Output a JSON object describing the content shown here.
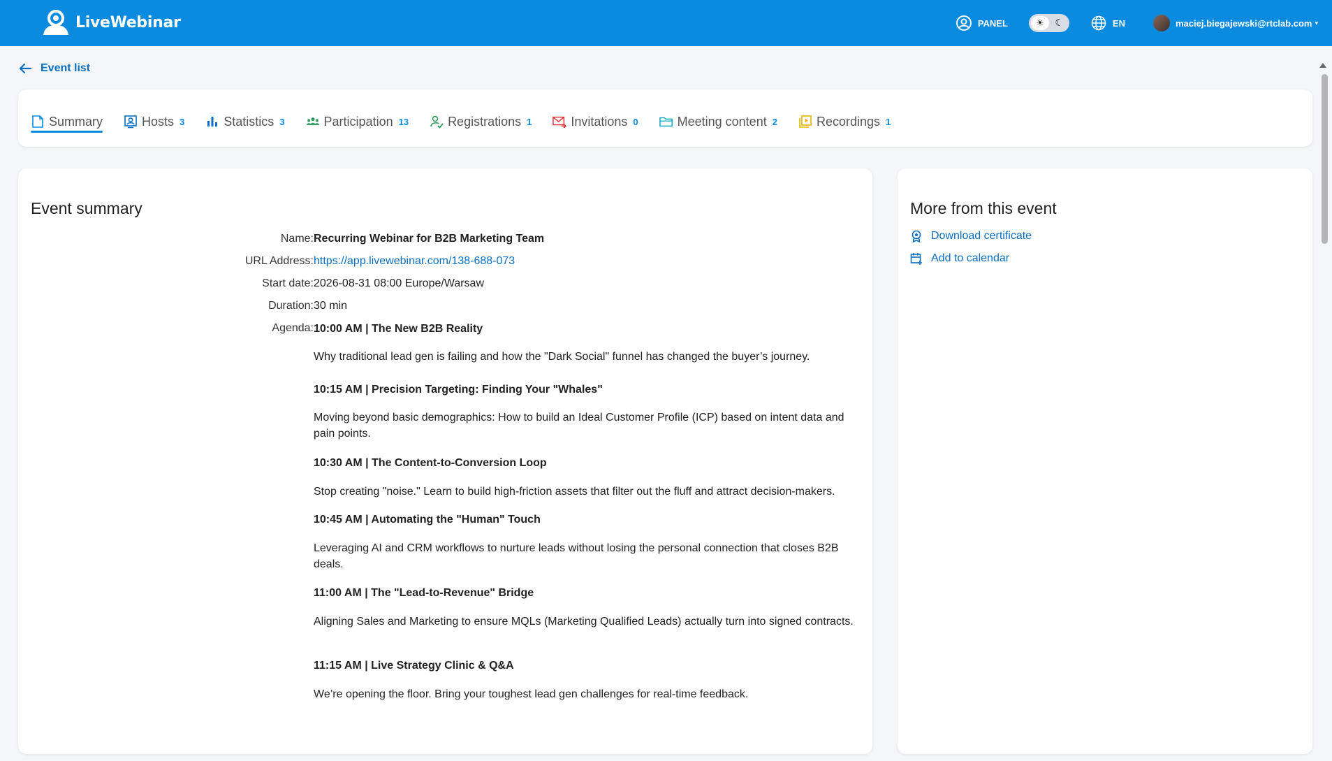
{
  "header": {
    "brand": "LiveWebinar",
    "panel_label": "PANEL",
    "language": "EN",
    "user_email": "maciej.biegajewski@rtclab.com",
    "accent_color": "#0a8be0"
  },
  "back_link": {
    "label": "Event list"
  },
  "tabs": [
    {
      "label": "Summary",
      "count": "",
      "icon": "summary-icon",
      "active": true
    },
    {
      "label": "Hosts",
      "count": "3",
      "icon": "hosts-icon"
    },
    {
      "label": "Statistics",
      "count": "3",
      "icon": "statistics-icon"
    },
    {
      "label": "Participation",
      "count": "13",
      "icon": "participation-icon"
    },
    {
      "label": "Registrations",
      "count": "1",
      "icon": "registrations-icon"
    },
    {
      "label": "Invitations",
      "count": "0",
      "icon": "invitations-icon"
    },
    {
      "label": "Meeting content",
      "count": "2",
      "icon": "folder-icon"
    },
    {
      "label": "Recordings",
      "count": "1",
      "icon": "recordings-icon"
    }
  ],
  "summary": {
    "title": "Event summary",
    "name_label": "Name:",
    "name": "Recurring Webinar for B2B Marketing Team",
    "url_label": "URL Address:",
    "url": "https://app.livewebinar.com/138-688-073",
    "start_label": "Start date:",
    "start": "2026-08-31 08:00 Europe/Warsaw",
    "duration_label": "Duration:",
    "duration": "30 min",
    "agenda_label": "Agenda:",
    "agenda": [
      {
        "heading": "10:00 AM | The New B2B Reality",
        "text": "Why traditional lead gen is failing and how the \"Dark Social\" funnel has changed the buyer’s journey."
      },
      {
        "heading": "10:15 AM | Precision Targeting: Finding Your \"Whales\"",
        "text": "Moving beyond basic demographics: How to build an Ideal Customer Profile (ICP) based on intent data and pain points."
      },
      {
        "heading": "10:30 AM | The Content-to-Conversion Loop",
        "text": "Stop creating \"noise.\" Learn to build high-friction assets that filter out the fluff and attract decision-makers."
      },
      {
        "heading": "10:45 AM | Automating the \"Human\" Touch",
        "text": "Leveraging AI and CRM workflows to nurture leads without losing the personal connection that closes B2B deals."
      },
      {
        "heading": "11:00 AM | The \"Lead-to-Revenue\" Bridge",
        "text": "Aligning Sales and Marketing to ensure MQLs (Marketing Qualified Leads) actually turn into signed contracts."
      },
      {
        "heading": "11:15 AM | Live Strategy Clinic & Q&A",
        "text": "We’re opening the floor. Bring your toughest lead gen challenges for real-time feedback."
      }
    ]
  },
  "more": {
    "title": "More from this event",
    "download_certificate": "Download certificate",
    "add_to_calendar": "Add to calendar"
  }
}
